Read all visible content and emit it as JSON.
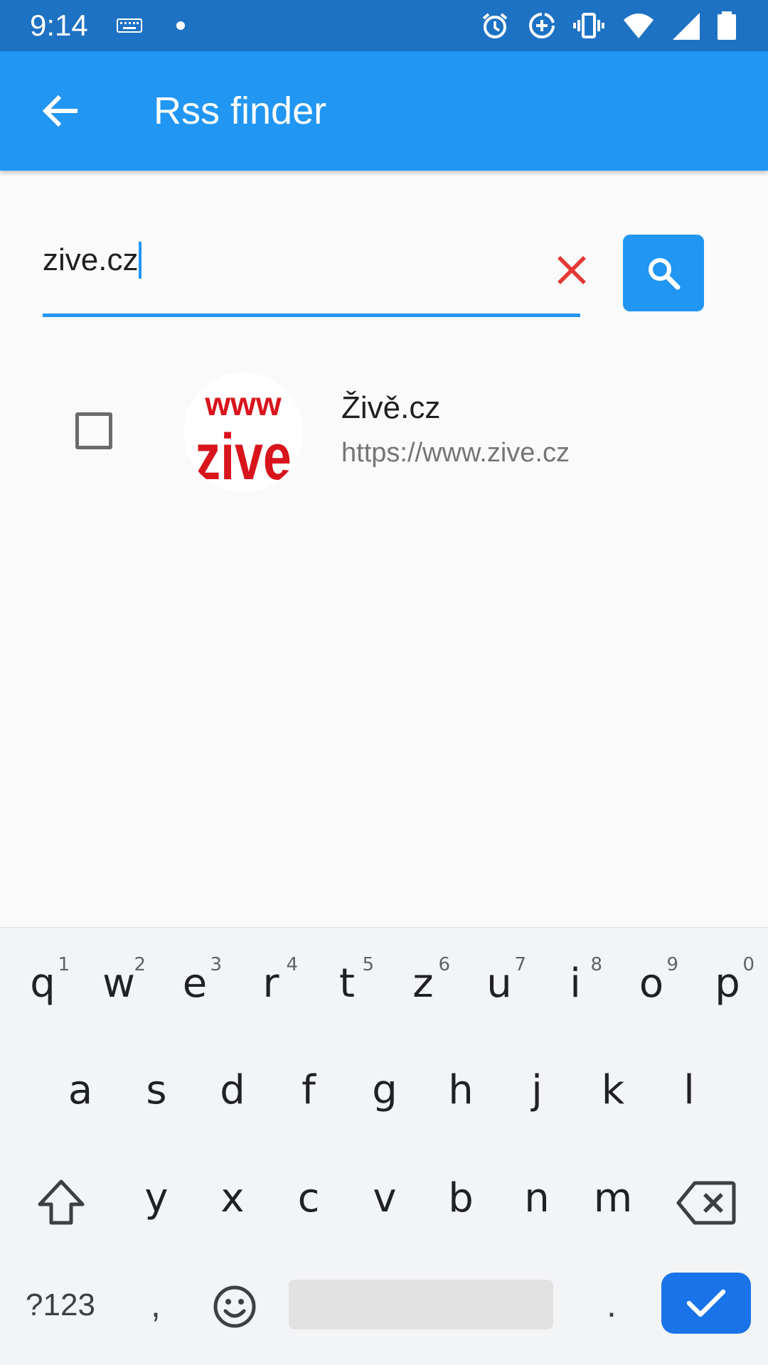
{
  "status_bar": {
    "time": "9:14",
    "icons": [
      "keyboard-icon",
      "notification-dot",
      "alarm-icon",
      "data-saver-icon",
      "vibrate-icon",
      "wifi-icon",
      "signal-icon",
      "battery-icon"
    ]
  },
  "app_bar": {
    "title": "Rss finder",
    "back_icon": "arrow-back-icon",
    "color": "#2196f3"
  },
  "search": {
    "value": "zive.cz",
    "clear_icon": "close-icon",
    "search_icon": "search-icon"
  },
  "results": [
    {
      "title": "Živě.cz",
      "url": "https://www.zive.cz",
      "checked": false,
      "logo_text_top": "www",
      "logo_text": "zive"
    }
  ],
  "keyboard": {
    "row1": [
      {
        "key": "q",
        "hint": "1"
      },
      {
        "key": "w",
        "hint": "2"
      },
      {
        "key": "e",
        "hint": "3"
      },
      {
        "key": "r",
        "hint": "4"
      },
      {
        "key": "t",
        "hint": "5"
      },
      {
        "key": "z",
        "hint": "6"
      },
      {
        "key": "u",
        "hint": "7"
      },
      {
        "key": "i",
        "hint": "8"
      },
      {
        "key": "o",
        "hint": "9"
      },
      {
        "key": "p",
        "hint": "0"
      }
    ],
    "row2": [
      "a",
      "s",
      "d",
      "f",
      "g",
      "h",
      "j",
      "k",
      "l"
    ],
    "row3": [
      "y",
      "x",
      "c",
      "v",
      "b",
      "n",
      "m"
    ],
    "symbols_label": "?123",
    "comma": ",",
    "period": ".",
    "accent_color": "#1a73e8"
  }
}
